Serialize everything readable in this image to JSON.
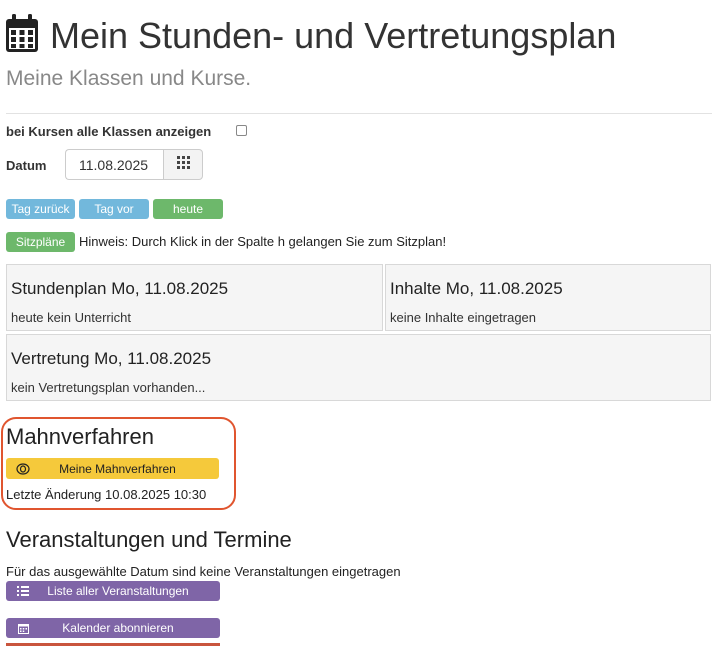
{
  "header": {
    "title": "Mein Stunden- und Vertretungsplan",
    "subtitle": "Meine Klassen und Kurse."
  },
  "options": {
    "show_all_classes_label": "bei Kursen alle Klassen anzeigen",
    "date_label": "Datum",
    "date_value": "11.08.2025"
  },
  "nav_buttons": {
    "prev_day": "Tag zurück",
    "next_day": "Tag vor",
    "today": "heute"
  },
  "seating": {
    "button_label": "Sitzpläne",
    "hint": "Hinweis: Durch Klick in der Spalte h gelangen Sie zum Sitzplan!"
  },
  "panels": {
    "timetable": {
      "title": "Stundenplan Mo, 11.08.2025",
      "text": "heute kein Unterricht"
    },
    "contents": {
      "title": "Inhalte Mo, 11.08.2025",
      "text": "keine Inhalte eingetragen"
    },
    "substitution": {
      "title": "Vertretung Mo, 11.08.2025",
      "text": "kein Vertretungsplan vorhanden..."
    }
  },
  "reminders": {
    "title": "Mahnverfahren",
    "button_label": "Meine Mahnverfahren",
    "last_change": "Letzte Änderung 10.08.2025 10:30"
  },
  "events": {
    "title": "Veranstaltungen und Termine",
    "empty_text": "Für das ausgewählte Datum sind keine Veranstaltungen eingetragen",
    "list_button": "Liste aller Veranstaltungen",
    "calendar_button": "Kalender abonnieren"
  },
  "colors": {
    "info_button": "#72b8dc",
    "success_button": "#6db86b",
    "reminder_button": "#f5c93b",
    "events_button": "#7f65a7",
    "highlight_border": "#e0552f"
  },
  "icons": {
    "header": "calendar-icon",
    "date_picker": "grid-icon",
    "reminder": "disc-icon",
    "list": "list-icon",
    "calendar": "calendar-small-icon"
  }
}
